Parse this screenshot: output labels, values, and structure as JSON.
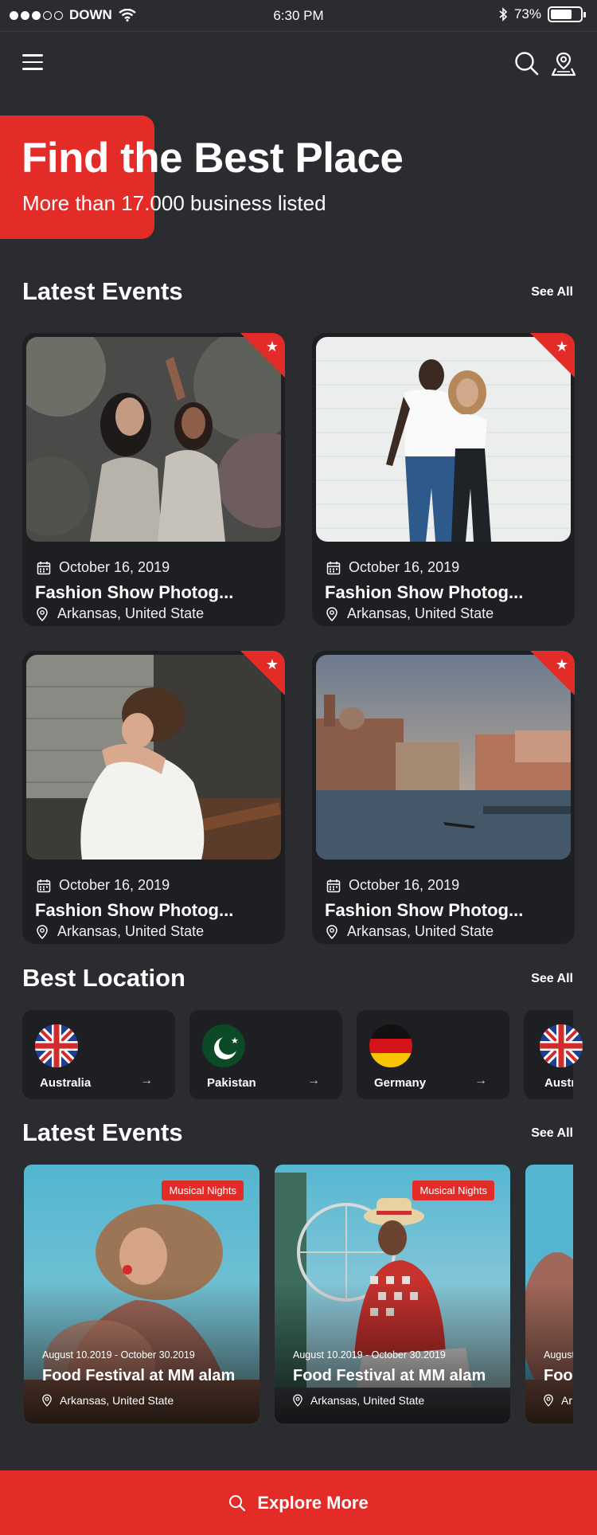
{
  "status": {
    "carrier": "DOWN",
    "time": "6:30 PM",
    "battery": "73%"
  },
  "hero": {
    "title": "Find the Best Place",
    "subtitle": "More than 17.000 business listed"
  },
  "latest_events": {
    "title": "Latest Events",
    "see_all": "See All",
    "cards": [
      {
        "date": "October 16, 2019",
        "title": "Fashion Show Photog...",
        "location": "Arkansas, United State"
      },
      {
        "date": "October 16, 2019",
        "title": "Fashion Show Photog...",
        "location": "Arkansas, United State"
      },
      {
        "date": "October 16, 2019",
        "title": "Fashion Show Photog...",
        "location": "Arkansas, United State"
      },
      {
        "date": "October 16, 2019",
        "title": "Fashion Show Photog...",
        "location": "Arkansas, United State"
      }
    ]
  },
  "best_location": {
    "title": "Best Location",
    "see_all": "See All",
    "items": [
      {
        "name": "Australia"
      },
      {
        "name": "Pakistan"
      },
      {
        "name": "Germany"
      },
      {
        "name": "Austr"
      }
    ]
  },
  "latest_events_2": {
    "title": "Latest Events",
    "see_all": "See All",
    "cards": [
      {
        "badge": "Musical Nights",
        "dates": "August 10.2019  -  October 30.2019",
        "title": "Food Festival at MM alam",
        "location": "Arkansas, United State"
      },
      {
        "badge": "Musical Nights",
        "dates": "August 10.2019  -  October 30.2019",
        "title": "Food Festival at MM alam",
        "location": "Arkansas, United State"
      },
      {
        "badge": "",
        "dates": "August",
        "title": "Food",
        "location": "Ar"
      }
    ]
  },
  "explore": {
    "label": "Explore More"
  },
  "colors": {
    "accent": "#e32c27",
    "background": "#2b2c30",
    "card": "#1e1f22"
  }
}
